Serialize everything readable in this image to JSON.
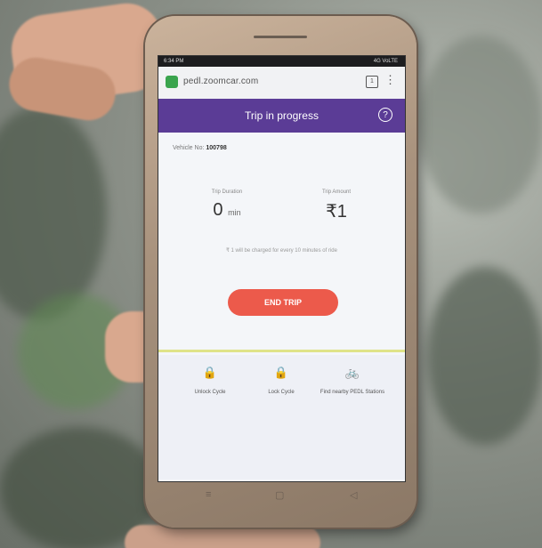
{
  "status_bar": {
    "time": "6:34 PM",
    "right_text": "4G VoLTE"
  },
  "browser": {
    "url": "pedl.zoomcar.com",
    "tab_count": "1",
    "menu_glyph": "⋮"
  },
  "header": {
    "title": "Trip in progress",
    "help_glyph": "?"
  },
  "vehicle": {
    "label": "Vehicle No:",
    "number": "100798"
  },
  "stats": [
    {
      "label": "Trip Duration",
      "value": "0",
      "unit": "min"
    },
    {
      "label": "Trip Amount",
      "value": "₹1",
      "unit": ""
    }
  ],
  "note": "₹ 1 will be charged for every 10 minutes of ride",
  "end_trip": "END TRIP",
  "actions": [
    {
      "icon": "lock-icon",
      "glyph": "🔒",
      "label": "Unlock Cycle"
    },
    {
      "icon": "lock-icon",
      "glyph": "🔒",
      "label": "Lock Cycle"
    },
    {
      "icon": "bicycle-icon",
      "glyph": "🚲",
      "label": "Find nearby PEDL Stations"
    }
  ],
  "nav_keys": [
    "≡",
    "▢",
    "◁"
  ]
}
